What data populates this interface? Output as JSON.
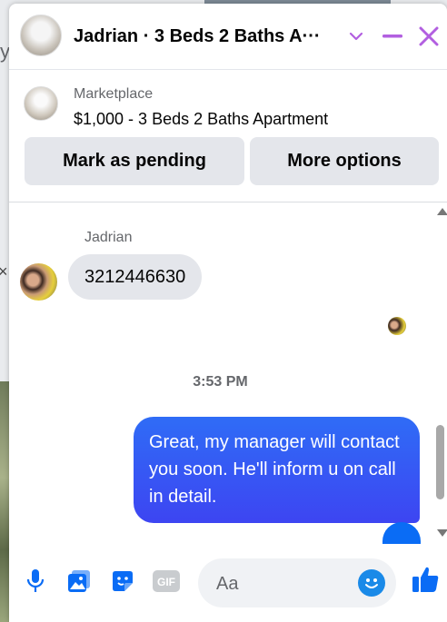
{
  "background": {
    "left_letter": "y",
    "close_glyph": "×"
  },
  "header": {
    "title": "Jadrian · 3 Beds 2 Baths A···"
  },
  "listing": {
    "source": "Marketplace",
    "title": "$1,000 - 3 Beds 2 Baths Apartment",
    "mark_pending_label": "Mark as pending",
    "more_options_label": "More options"
  },
  "messages": {
    "sender_name": "Jadrian",
    "incoming_text": "3212446630",
    "timestamp": "3:53 PM",
    "outgoing_text": "Great, my manager will contact you soon. He'll inform u on call in detail."
  },
  "composer": {
    "placeholder": "Aa"
  },
  "colors": {
    "accent": "#0a6cf5",
    "header_icons": "#b25fe0",
    "bubble_out": "#2f6cf6"
  },
  "icons": [
    "chevron-down-icon",
    "minimize-icon",
    "close-icon",
    "microphone-icon",
    "image-icon",
    "sticker-icon",
    "gif-icon",
    "emoji-icon",
    "thumbs-up-icon"
  ]
}
